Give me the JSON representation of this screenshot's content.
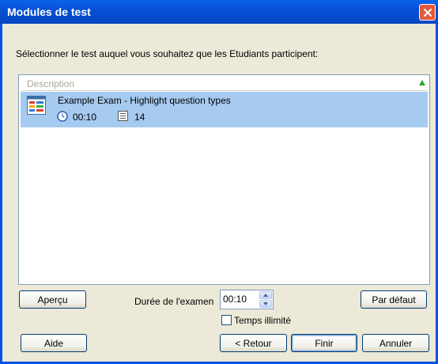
{
  "window": {
    "title": "Modules de test"
  },
  "instruction": "Sélectionner le test auquel vous souhaitez que les Etudiants participent:",
  "list": {
    "column_header": "Description",
    "items": [
      {
        "title": "Example Exam - Highlight question types",
        "duration": "00:10",
        "question_count": "14",
        "selected": true
      }
    ]
  },
  "buttons": {
    "preview": "Aperçu",
    "default": "Par défaut",
    "help": "Aide",
    "back": "< Retour",
    "finish": "Finir",
    "cancel": "Annuler"
  },
  "exam_duration": {
    "label": "Durée de l'examen",
    "value": "00:10"
  },
  "unlimited_time": {
    "label": "Temps illimité",
    "checked": false
  },
  "colors": {
    "titlebar": "#0551d6",
    "selection": "#a6caf0",
    "dialog_bg": "#ece9d8"
  }
}
